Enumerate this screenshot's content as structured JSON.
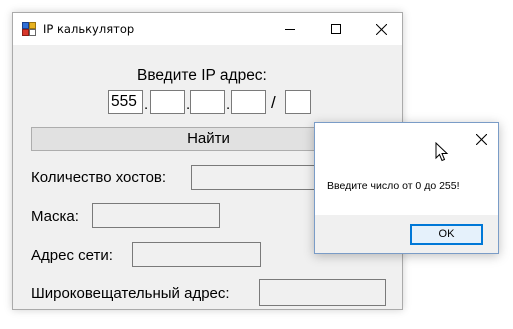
{
  "window": {
    "title": "IP калькулятор",
    "prompt": "Введите IP адрес:",
    "ip_octets": [
      "555",
      "",
      "",
      ""
    ],
    "octet_separator": ".",
    "prefix_separator": "/",
    "prefix": "",
    "find_button": "Найти",
    "hosts_label": "Количество хостов:",
    "mask_label": "Маска:",
    "network_label": "Адрес сети:",
    "broadcast_label": "Широковещательный адрес:"
  },
  "dialog": {
    "message": "Введите число от 0 до 255!",
    "ok_button": "OK"
  },
  "icons": {
    "app": "app-forms-icon",
    "minimize": "minimize-icon",
    "maximize": "maximize-icon",
    "close": "close-icon",
    "cursor": "mouse-pointer-icon"
  },
  "colors": {
    "window_bg": "#f0f0f0",
    "titlebar_bg": "#ffffff",
    "ok_border": "#0078d7",
    "ok_fill": "#e5f1fb"
  }
}
